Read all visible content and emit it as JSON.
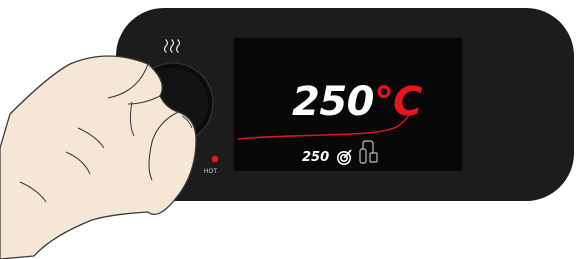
{
  "panel": {
    "hot_indicator_label": "HOT",
    "heat_icon": "heat-waves-icon"
  },
  "display": {
    "temperature_value": "250",
    "temperature_unit": "℃",
    "setpoint_value": "250",
    "setpoint_icon": "target-icon",
    "tool_icon": "soldering-iron-icon"
  },
  "colors": {
    "panel": "#1c1c1c",
    "screen": "#080808",
    "accent": "#e8141e",
    "text": "#ffffff",
    "skin": "#f6e6d6"
  }
}
